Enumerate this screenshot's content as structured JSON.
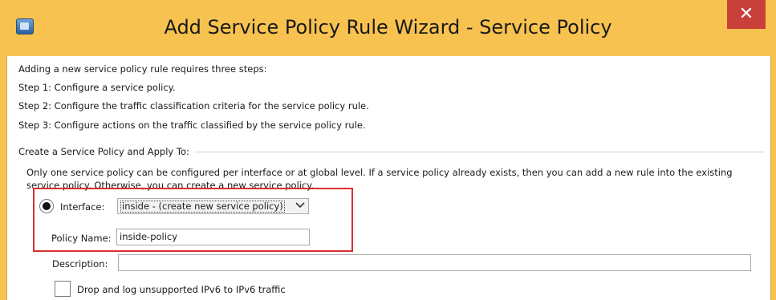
{
  "window": {
    "title": "Add Service Policy Rule Wizard - Service Policy",
    "close_symbol": "✕"
  },
  "intro": {
    "line1": "Adding a new service policy rule requires three steps:",
    "step1": "Step 1:  Configure a service policy.",
    "step2": "Step 2:  Configure the traffic classification criteria for the service policy rule.",
    "step3": "Step 3:  Configure actions on the traffic classified by the service policy rule."
  },
  "group": {
    "title": "Create a Service Policy and Apply To:",
    "description": "Only one service policy can be configured per interface or at global level. If a service policy already exists, then you can add a new rule into the existing service policy. Otherwise, you can create a new service policy."
  },
  "form": {
    "interface_label": "Interface:",
    "interface_selected": true,
    "interface_value": "inside - (create new service policy)",
    "dropdown_icon": "chevron-down-icon",
    "policy_name_label": "Policy Name:",
    "policy_name_value": "inside-policy",
    "description_label": "Description:",
    "description_value": "",
    "drop_ipv6_label": "Drop and log unsupported IPv6 to IPv6 traffic",
    "drop_ipv6_checked": false
  },
  "colors": {
    "title_bar": "#f7c24f",
    "close_button": "#c9403a",
    "highlight_box": "#d9302e"
  }
}
